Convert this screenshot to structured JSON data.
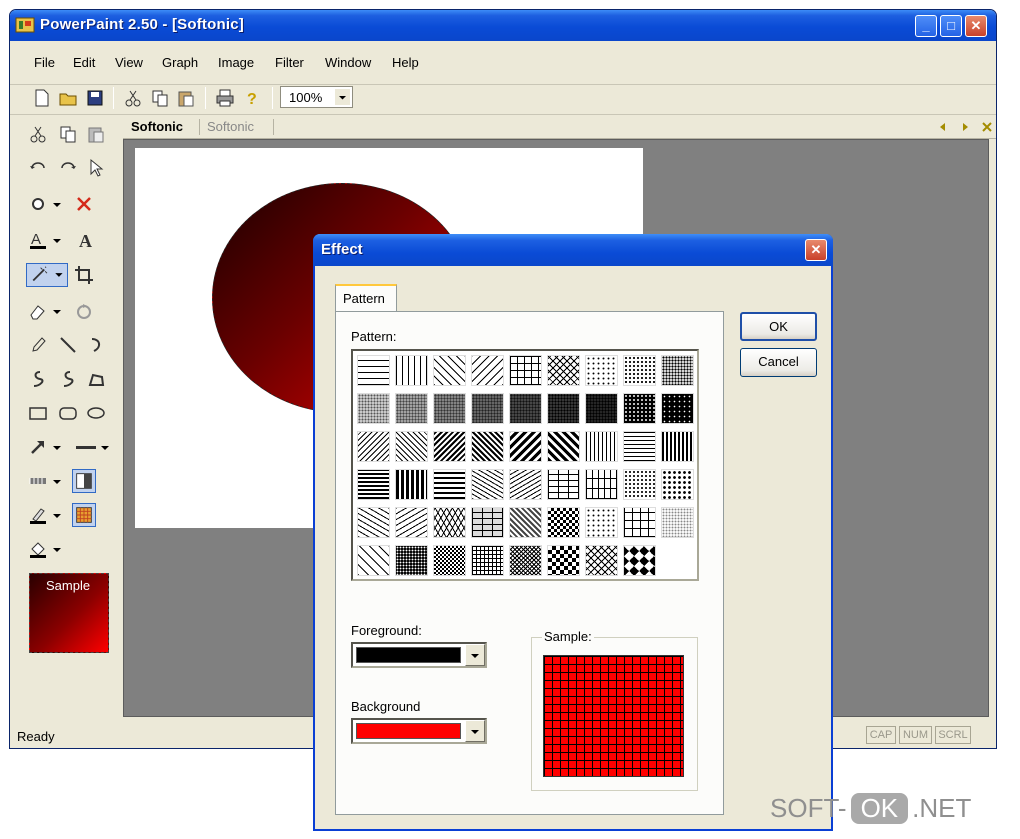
{
  "window": {
    "title": "PowerPaint 2.50 - [Softonic]"
  },
  "menu": [
    "File",
    "Edit",
    "View",
    "Graph",
    "Image",
    "Filter",
    "Window",
    "Help"
  ],
  "toolbar": {
    "zoom": "100%"
  },
  "doc_tabs": [
    "Softonic",
    "Softonic"
  ],
  "sidebar": {
    "sample_label": "Sample"
  },
  "status": {
    "text": "Ready",
    "indicators": [
      "CAP",
      "NUM",
      "SCRL"
    ]
  },
  "dialog": {
    "title": "Effect",
    "tab": "Pattern",
    "pattern_label": "Pattern:",
    "foreground_label": "Foreground:",
    "foreground_color": "#000000",
    "background_label": "Background",
    "background_color": "#ff0000",
    "sample_label": "Sample:",
    "ok_label": "OK",
    "cancel_label": "Cancel"
  },
  "watermark": {
    "left": "SOFT-",
    "middle": "OK",
    "right": ".NET"
  }
}
